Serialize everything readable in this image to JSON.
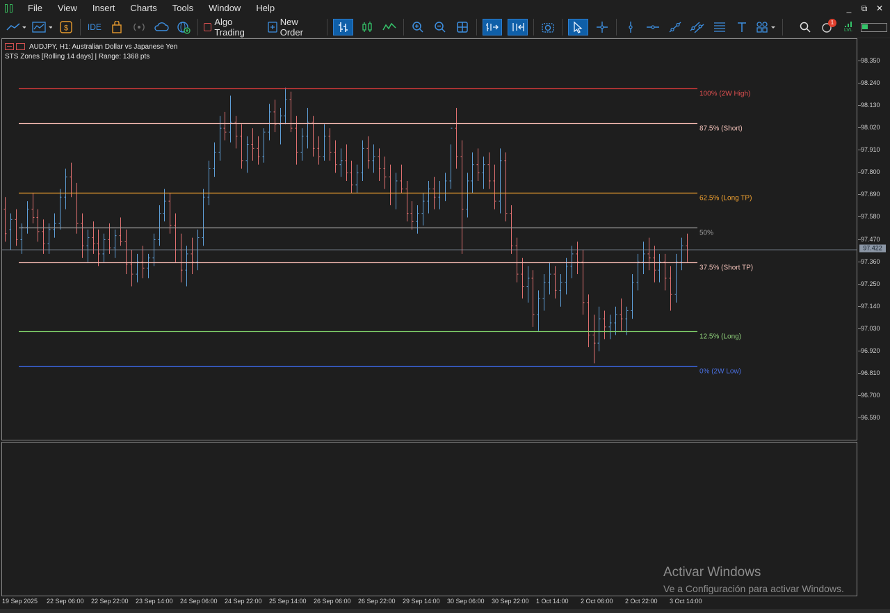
{
  "menu": {
    "items": [
      "File",
      "View",
      "Insert",
      "Charts",
      "Tools",
      "Window",
      "Help"
    ]
  },
  "window_controls": [
    "_",
    "⧉",
    "✕"
  ],
  "toolbar": {
    "ide_label": "IDE",
    "algo_trading_label": "Algo Trading",
    "new_order_label": "New Order",
    "notification_count": "1",
    "lvl_label": "LVL"
  },
  "chart": {
    "title": "AUDJPY, H1:  Australian Dollar vs Japanese Yen",
    "indicator": "STS Zones [Rolling 14 days] | Range: 1368 pts",
    "current_price": "97.422",
    "price_labels": [
      "98.350",
      "98.240",
      "98.130",
      "98.020",
      "97.910",
      "97.800",
      "97.690",
      "97.580",
      "97.470",
      "97.360",
      "97.250",
      "97.140",
      "97.030",
      "96.920",
      "96.810",
      "96.700",
      "96.590"
    ],
    "time_labels": [
      "19 Sep 2025",
      "22 Sep 06:00",
      "22 Sep 22:00",
      "23 Sep 14:00",
      "24 Sep 06:00",
      "24 Sep 22:00",
      "25 Sep 14:00",
      "26 Sep 06:00",
      "26 Sep 22:00",
      "29 Sep 14:00",
      "30 Sep 06:00",
      "30 Sep 22:00",
      "1 Oct 14:00",
      "2 Oct 06:00",
      "2 Oct 22:00",
      "3 Oct 14:00"
    ],
    "levels": [
      {
        "label": "100% (2W High)",
        "price": 98.215,
        "color": "#d63a3a",
        "text_color": "#e05050"
      },
      {
        "label": "87.5% (Short)",
        "price": 98.044,
        "color": "#f2b8b0",
        "text_color": "#f0c0b8"
      },
      {
        "label": "62.5% (Long TP)",
        "price": 97.702,
        "color": "#f3a331",
        "text_color": "#f3a331"
      },
      {
        "label": "50%",
        "price": 97.531,
        "color": "#9a9a9a",
        "text_color": "#a0a0a0"
      },
      {
        "label": "37.5% (Short TP)",
        "price": 97.36,
        "color": "#f2b8b0",
        "text_color": "#f0c0b8"
      },
      {
        "label": "12.5% (Long)",
        "price": 97.018,
        "color": "#7fd06a",
        "text_color": "#8fd07a"
      },
      {
        "label": "0% (2W Low)",
        "price": 96.847,
        "color": "#3a63d8",
        "text_color": "#4a70e0"
      }
    ],
    "bull_color": "#5f9fd8",
    "bear_color": "#e07070",
    "bars": [
      [
        97.62,
        97.68,
        97.46,
        97.5
      ],
      [
        97.52,
        97.6,
        97.42,
        97.57
      ],
      [
        97.57,
        97.62,
        97.44,
        97.47
      ],
      [
        97.47,
        97.55,
        97.4,
        97.53
      ],
      [
        97.53,
        97.66,
        97.5,
        97.62
      ],
      [
        97.62,
        97.7,
        97.55,
        97.58
      ],
      [
        97.58,
        97.62,
        97.46,
        97.51
      ],
      [
        97.51,
        97.57,
        97.4,
        97.45
      ],
      [
        97.45,
        97.55,
        97.4,
        97.52
      ],
      [
        97.52,
        97.6,
        97.48,
        97.55
      ],
      [
        97.55,
        97.72,
        97.52,
        97.68
      ],
      [
        97.68,
        97.82,
        97.62,
        97.78
      ],
      [
        97.78,
        97.85,
        97.68,
        97.7
      ],
      [
        97.7,
        97.75,
        97.5,
        97.55
      ],
      [
        97.55,
        97.6,
        97.38,
        97.44
      ],
      [
        97.44,
        97.52,
        97.36,
        97.48
      ],
      [
        97.48,
        97.56,
        97.4,
        97.45
      ],
      [
        97.45,
        97.52,
        97.34,
        97.4
      ],
      [
        97.4,
        97.5,
        97.36,
        97.47
      ],
      [
        97.47,
        97.55,
        97.4,
        97.43
      ],
      [
        97.43,
        97.52,
        97.38,
        97.49
      ],
      [
        97.49,
        97.58,
        97.44,
        97.46
      ],
      [
        97.46,
        97.52,
        97.3,
        97.35
      ],
      [
        97.35,
        97.42,
        97.24,
        97.3
      ],
      [
        97.3,
        97.4,
        97.26,
        97.36
      ],
      [
        97.36,
        97.44,
        97.28,
        97.33
      ],
      [
        97.33,
        97.4,
        97.28,
        97.38
      ],
      [
        97.38,
        97.5,
        97.34,
        97.47
      ],
      [
        97.47,
        97.64,
        97.44,
        97.6
      ],
      [
        97.6,
        97.72,
        97.56,
        97.66
      ],
      [
        97.66,
        97.7,
        97.5,
        97.54
      ],
      [
        97.54,
        97.6,
        97.36,
        97.42
      ],
      [
        97.42,
        97.5,
        97.26,
        97.32
      ],
      [
        97.32,
        97.44,
        97.24,
        97.4
      ],
      [
        97.4,
        97.48,
        97.3,
        97.36
      ],
      [
        97.36,
        97.52,
        97.32,
        97.48
      ],
      [
        97.48,
        97.72,
        97.44,
        97.68
      ],
      [
        97.68,
        97.86,
        97.64,
        97.82
      ],
      [
        97.82,
        97.95,
        97.78,
        97.9
      ],
      [
        97.9,
        98.08,
        97.86,
        98.02
      ],
      [
        98.02,
        98.1,
        97.96,
        98.0
      ],
      [
        98.0,
        98.18,
        97.95,
        98.05
      ],
      [
        98.05,
        98.08,
        97.92,
        97.98
      ],
      [
        97.98,
        98.04,
        97.82,
        97.86
      ],
      [
        97.86,
        97.98,
        97.8,
        97.94
      ],
      [
        97.94,
        98.02,
        97.86,
        97.92
      ],
      [
        97.92,
        97.98,
        97.84,
        97.88
      ],
      [
        97.88,
        98.02,
        97.85,
        98.0
      ],
      [
        98.0,
        98.14,
        97.96,
        98.1
      ],
      [
        98.1,
        98.16,
        98.0,
        98.04
      ],
      [
        98.04,
        98.12,
        97.94,
        98.08
      ],
      [
        98.08,
        98.22,
        98.04,
        98.16
      ],
      [
        98.16,
        98.2,
        98.0,
        98.02
      ],
      [
        98.02,
        98.08,
        97.84,
        97.9
      ],
      [
        97.9,
        98.02,
        97.86,
        97.98
      ],
      [
        97.98,
        98.12,
        97.92,
        98.05
      ],
      [
        98.05,
        98.08,
        97.88,
        97.92
      ],
      [
        97.92,
        97.98,
        97.84,
        97.88
      ],
      [
        97.88,
        98.04,
        97.86,
        97.98
      ],
      [
        97.98,
        98.02,
        97.86,
        97.9
      ],
      [
        97.9,
        97.96,
        97.8,
        97.84
      ],
      [
        97.84,
        97.92,
        97.78,
        97.86
      ],
      [
        97.86,
        97.94,
        97.76,
        97.8
      ],
      [
        97.8,
        97.86,
        97.7,
        97.74
      ],
      [
        97.74,
        97.84,
        97.7,
        97.8
      ],
      [
        97.8,
        97.96,
        97.76,
        97.92
      ],
      [
        97.92,
        97.98,
        97.82,
        97.86
      ],
      [
        97.86,
        97.94,
        97.8,
        97.88
      ],
      [
        97.88,
        97.92,
        97.76,
        97.82
      ],
      [
        97.82,
        97.88,
        97.72,
        97.78
      ],
      [
        97.78,
        97.84,
        97.64,
        97.7
      ],
      [
        97.7,
        97.8,
        97.62,
        97.76
      ],
      [
        97.76,
        97.84,
        97.7,
        97.72
      ],
      [
        97.72,
        97.76,
        97.56,
        97.6
      ],
      [
        97.6,
        97.66,
        97.52,
        97.56
      ],
      [
        97.56,
        97.64,
        97.5,
        97.6
      ],
      [
        97.6,
        97.7,
        97.54,
        97.66
      ],
      [
        97.66,
        97.76,
        97.6,
        97.72
      ],
      [
        97.72,
        97.78,
        97.62,
        97.68
      ],
      [
        97.68,
        97.76,
        97.62,
        97.7
      ],
      [
        97.7,
        97.8,
        97.66,
        97.76
      ],
      [
        97.76,
        97.94,
        97.72,
        98.02
      ],
      [
        98.02,
        98.12,
        97.82,
        97.88
      ],
      [
        97.88,
        97.96,
        97.4,
        97.62
      ],
      [
        97.62,
        97.8,
        97.58,
        97.76
      ],
      [
        97.76,
        97.9,
        97.7,
        97.84
      ],
      [
        97.84,
        97.92,
        97.76,
        97.8
      ],
      [
        97.8,
        97.88,
        97.72,
        97.84
      ],
      [
        97.84,
        97.9,
        97.72,
        97.76
      ],
      [
        97.76,
        97.84,
        97.62,
        97.66
      ],
      [
        97.66,
        97.92,
        97.6,
        97.86
      ],
      [
        97.86,
        97.9,
        97.56,
        97.6
      ],
      [
        97.6,
        97.64,
        97.4,
        97.44
      ],
      [
        97.44,
        97.48,
        97.26,
        97.3
      ],
      [
        97.3,
        97.38,
        97.18,
        97.24
      ],
      [
        97.24,
        97.34,
        97.16,
        97.28
      ],
      [
        97.28,
        97.32,
        97.04,
        97.1
      ],
      [
        97.1,
        97.22,
        97.02,
        97.18
      ],
      [
        97.18,
        97.3,
        97.12,
        97.26
      ],
      [
        97.26,
        97.36,
        97.2,
        97.3
      ],
      [
        97.3,
        97.34,
        97.18,
        97.22
      ],
      [
        97.22,
        97.3,
        97.14,
        97.26
      ],
      [
        97.26,
        97.38,
        97.2,
        97.34
      ],
      [
        97.34,
        97.44,
        97.28,
        97.4
      ],
      [
        97.4,
        97.46,
        97.3,
        97.36
      ],
      [
        97.36,
        97.42,
        97.1,
        97.16
      ],
      [
        97.16,
        97.2,
        96.94,
        97.0
      ],
      [
        97.0,
        97.1,
        96.86,
        96.96
      ],
      [
        96.96,
        97.14,
        96.92,
        97.08
      ],
      [
        97.08,
        97.12,
        96.98,
        97.04
      ],
      [
        97.04,
        97.1,
        96.98,
        97.06
      ],
      [
        97.06,
        97.14,
        97.0,
        97.1
      ],
      [
        97.1,
        97.18,
        97.02,
        97.08
      ],
      [
        97.08,
        97.14,
        97.0,
        97.12
      ],
      [
        97.12,
        97.3,
        97.08,
        97.26
      ],
      [
        97.26,
        97.4,
        97.22,
        97.36
      ],
      [
        97.36,
        97.46,
        97.3,
        97.4
      ],
      [
        97.4,
        97.48,
        97.32,
        97.38
      ],
      [
        97.38,
        97.44,
        97.26,
        97.32
      ],
      [
        97.32,
        97.4,
        97.26,
        97.36
      ],
      [
        97.36,
        97.4,
        97.22,
        97.28
      ],
      [
        97.28,
        97.34,
        97.12,
        97.2
      ],
      [
        97.2,
        97.4,
        97.16,
        97.36
      ],
      [
        97.36,
        97.48,
        97.32,
        97.44
      ],
      [
        97.44,
        97.5,
        97.36,
        97.42
      ]
    ]
  },
  "watermark": {
    "line1": "Activar Windows",
    "line2": "Ve a Configuración para activar Windows."
  }
}
